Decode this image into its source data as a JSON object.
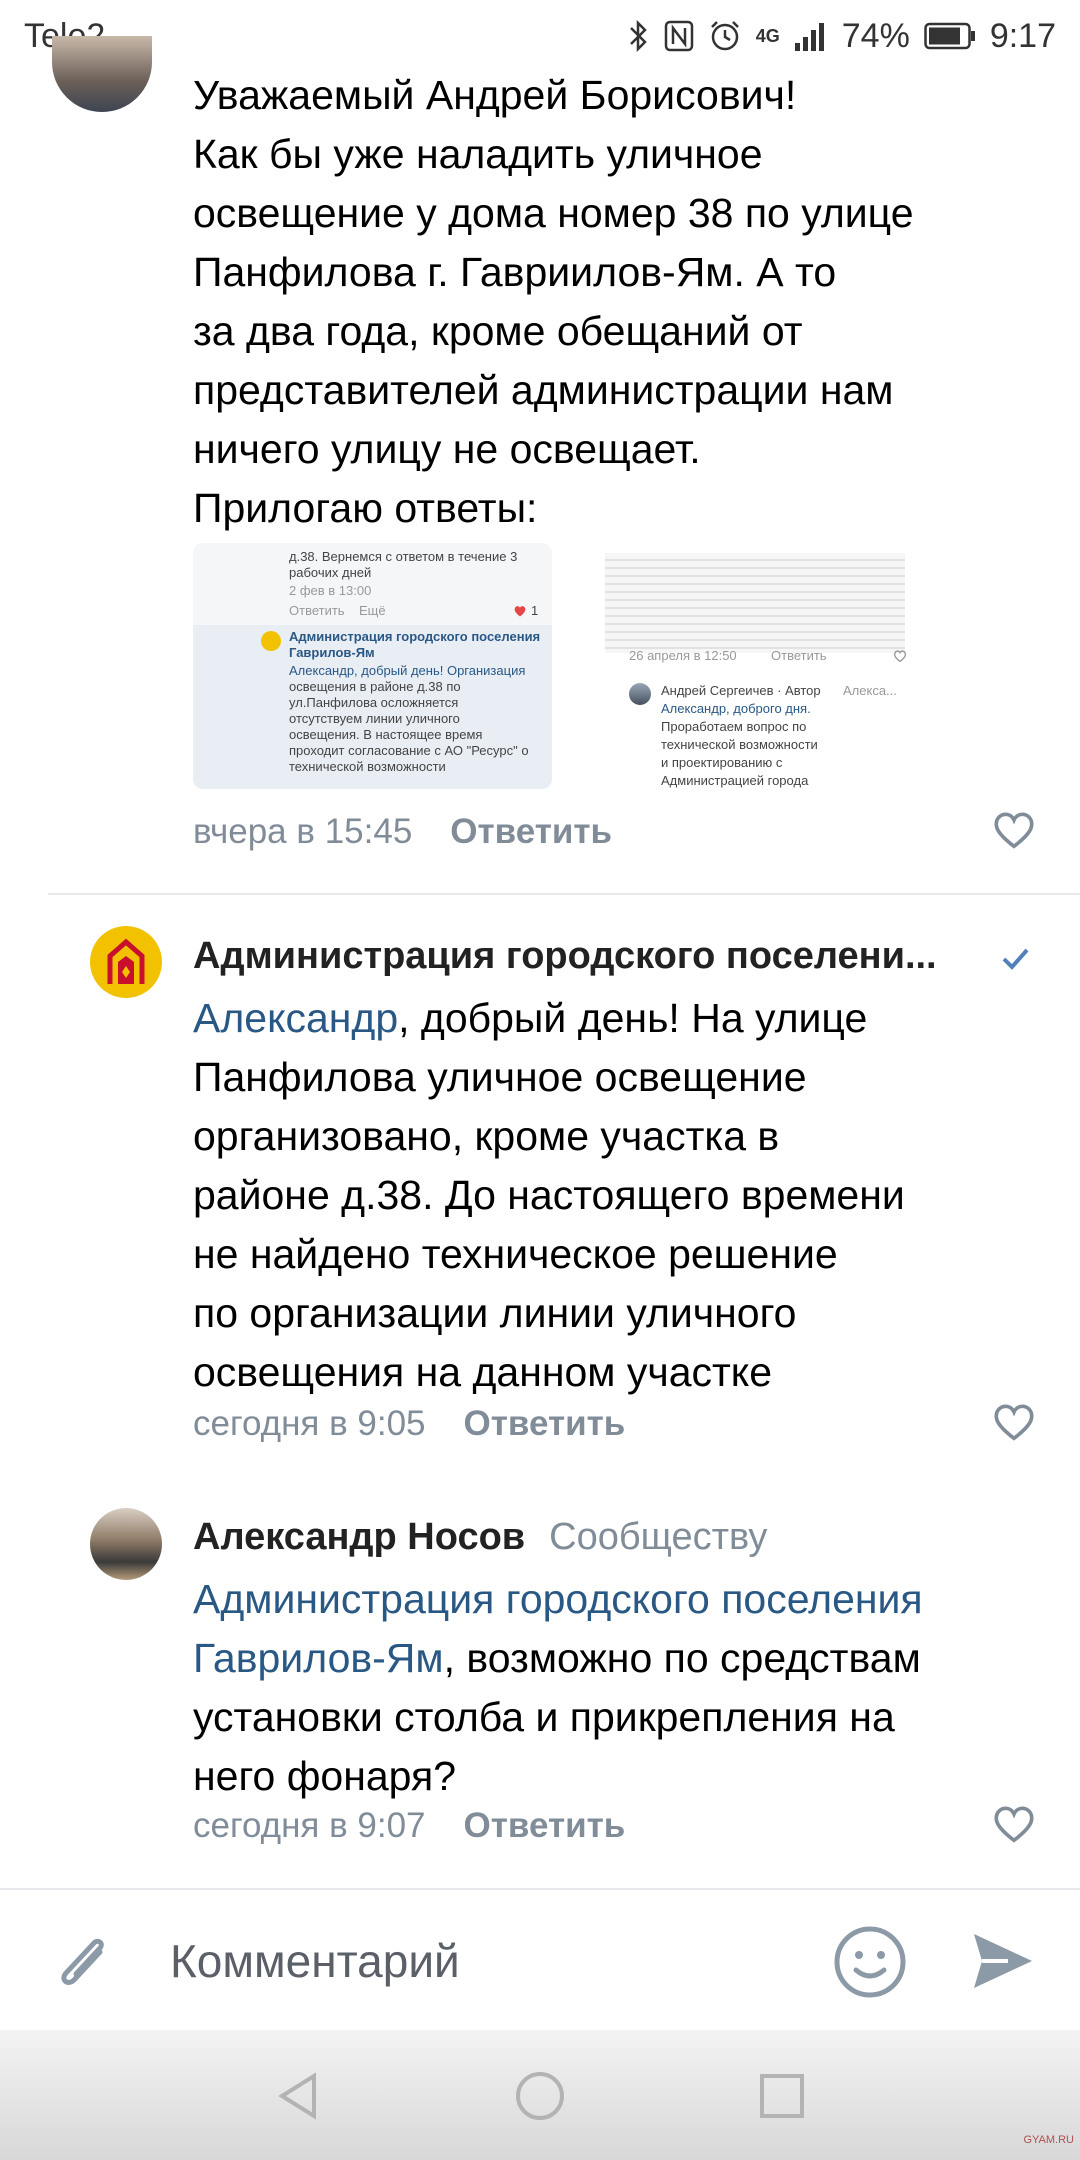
{
  "status_bar": {
    "carrier": "Tele2",
    "network": "4G",
    "battery": "74%",
    "time": "9:17"
  },
  "comment1": {
    "text": "Уважаемый Андрей Борисович!\nКак бы уже наладить уличное\nосвещение у дома номер 38 по улице\nПанфилова г. Гавриилов-Ям. А то\nза два года,  кроме обещаний от\nпредставителей администрации нам\nничего улицу не освещает.\nПрилогаю ответы:",
    "time": "вчера в 15:45",
    "reply": "Ответить"
  },
  "attachment1": {
    "line1": "д.38. Вернемся с ответом в течение 3",
    "line2": "рабочих дней",
    "date": "2 фев в 13:00",
    "reply": "Ответить",
    "more": "Ещё",
    "likes": "1",
    "org_line1": "Администрация городского поселения",
    "org_line2": "Гаврилов-Ям",
    "text_l1": "Александр, добрый день! Организация",
    "text_l2": "освещения в районе д.38 по",
    "text_l3": "ул.Панфилова осложняется",
    "text_l4": "отсутствуем линии уличного",
    "text_l5": "освещения. В настоящее время",
    "text_l6": "проходит согласование с АО \"Ресурс\" о",
    "text_l7": "технической возможности"
  },
  "attachment2": {
    "date": "26 апреля в 12:50",
    "reply": "Ответить",
    "author": "Андрей Сергеичев · Автор",
    "author_suffix": "Алекса...",
    "text_l1": "Александр, доброго дня.",
    "text_l2": "Проработаем вопрос по",
    "text_l3": "технической возможности",
    "text_l4": "и проектированию с",
    "text_l5": "Администрацией города"
  },
  "comment2": {
    "author": "Администрация городского поселени...",
    "mention": "Александр",
    "text": ", добрый день! На улице\nПанфилова уличное освещение\nорганизовано, кроме участка в\nрайоне д.38. До настоящего времени\nне найдено техническое решение\nпо организации линии уличного\nосвещения на данном участке",
    "time": "сегодня в 9:05",
    "reply": "Ответить"
  },
  "comment3": {
    "author": "Александр Носов",
    "author_sub": "Сообществу",
    "mention": "Администрация городского поселения\nГаврилов-Ям",
    "text": ", возможно по средствам\nустановки столба и прикрепления на\nнего фонаря?",
    "time": "сегодня в 9:07",
    "reply": "Ответить"
  },
  "input": {
    "placeholder": "Комментарий"
  },
  "watermark": "GYAM.RU",
  "colors": {
    "link": "#2a5885",
    "meta": "#818c99",
    "verified": "#5181b8",
    "emblem_yellow": "#f2c200",
    "emblem_red": "#c8102e"
  },
  "icons": [
    "paperclip-icon",
    "smile-icon",
    "send-icon",
    "heart-icon",
    "verified-icon",
    "bluetooth-icon",
    "nfc-icon",
    "alarm-icon",
    "signal-icon",
    "battery-icon",
    "back-icon",
    "home-icon",
    "recents-icon"
  ]
}
